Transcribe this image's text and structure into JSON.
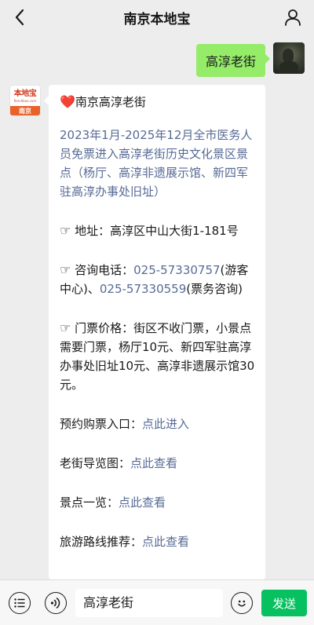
{
  "header": {
    "title": "南京本地宝",
    "back_icon": "chevron-left-icon",
    "profile_icon": "user-icon"
  },
  "messages": {
    "sent": {
      "text": "高淳老街"
    },
    "bot": {
      "avatar": {
        "logo": "本地宝",
        "sub": "Bendibao.com",
        "city": "南京"
      },
      "heart": "❤️",
      "heading": "南京高淳老街",
      "notice": "2023年1月-2025年12月全市医务人员免票进入高淳老街历史文化景区景点（杨厅、高淳非遗展示馆、新四军驻高淳办事处旧址）",
      "hand": "☞",
      "address_label": "地址：",
      "address_value": "高淳区中山大街1-181号",
      "phone_label": "咨询电话：",
      "phone1": "025-57330757",
      "phone1_note": "(游客中心)、",
      "phone2": "025-57330559",
      "phone2_note": "(票务咨询)",
      "ticket_label": "门票价格：",
      "ticket_value": "街区不收门票，小景点需要门票，杨厅10元、新四军驻高淳办事处旧址10元、高淳非遗展示馆30元。",
      "links": [
        {
          "label": "预约购票入口：",
          "link": "点此进入"
        },
        {
          "label": "老街导览图：",
          "link": "点此查看"
        },
        {
          "label": "景点一览：",
          "link": "点此查看"
        },
        {
          "label": "旅游路线推荐：",
          "link": "点此查看"
        }
      ]
    }
  },
  "composer": {
    "input_value": "高淳老街",
    "send_label": "发送",
    "menu_icon": "menu-icon",
    "voice_icon": "voice-icon",
    "emoji_icon": "emoji-icon"
  },
  "colors": {
    "green_bubble": "#95ec69",
    "link": "#576b95",
    "send_button": "#07c160"
  }
}
